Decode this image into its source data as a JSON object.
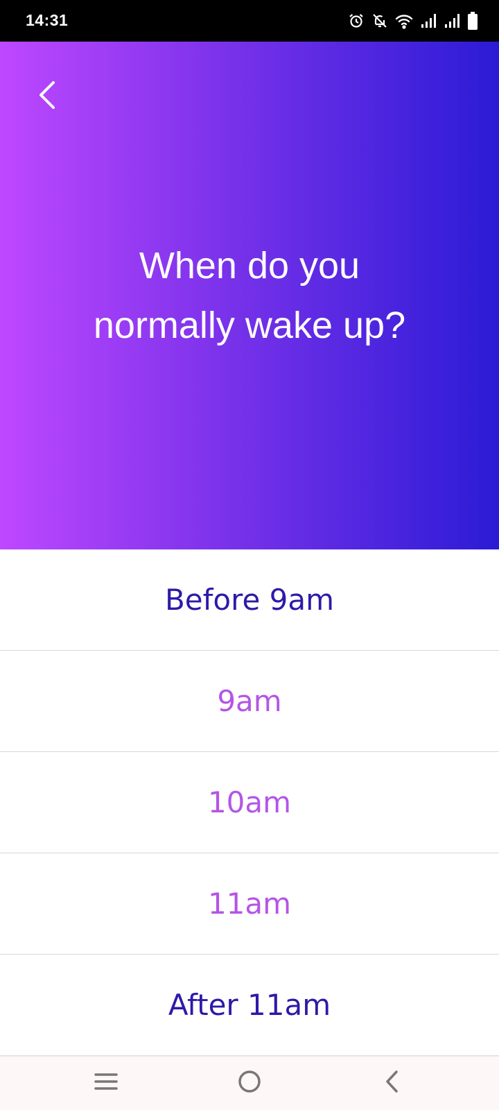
{
  "status_bar": {
    "time": "14:31",
    "icons": [
      "alarm-icon",
      "notifications-off-icon",
      "wifi-icon",
      "signal-icon",
      "signal-icon",
      "battery-icon"
    ]
  },
  "header": {
    "back_icon": "chevron-left-icon",
    "question_line1": "When do you",
    "question_line2": "normally wake up?"
  },
  "options": [
    {
      "label": "Before 9am"
    },
    {
      "label": "9am"
    },
    {
      "label": "10am"
    },
    {
      "label": "11am"
    },
    {
      "label": "After 11am"
    }
  ],
  "nav_bar": {
    "icons": [
      "menu-icon",
      "home-circle-icon",
      "back-icon"
    ]
  },
  "colors": {
    "gradient_start": "#be48ff",
    "gradient_end": "#2b1bd6",
    "option_strong": "#2d1aa8",
    "option_soft": "#b455e6"
  }
}
